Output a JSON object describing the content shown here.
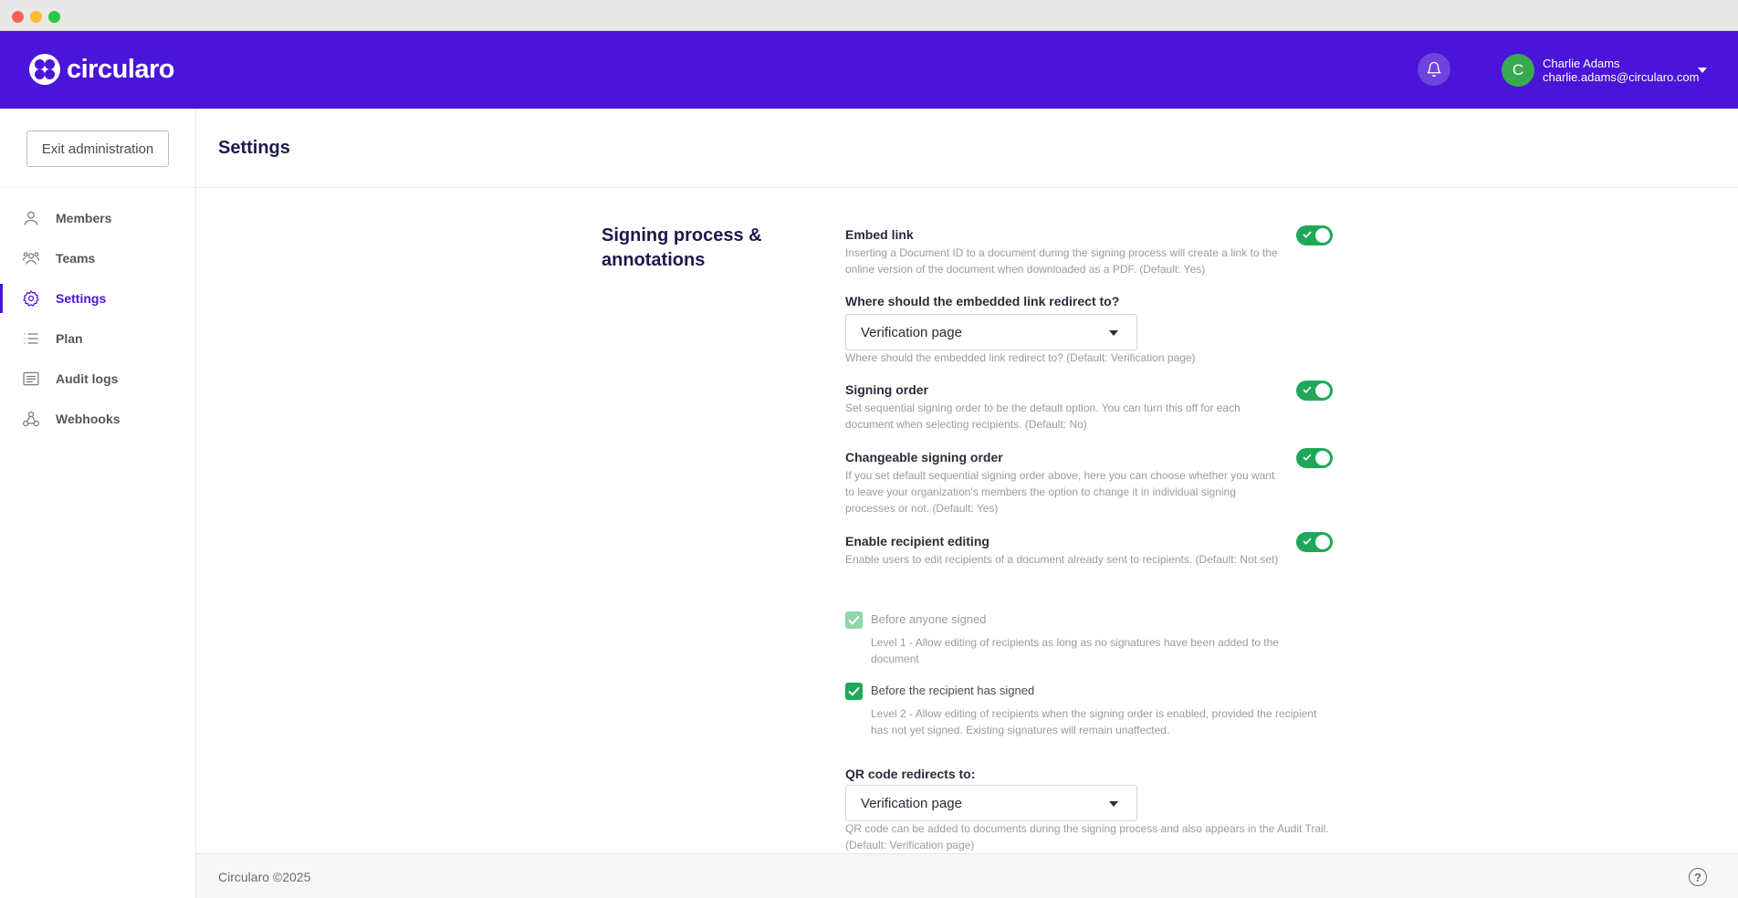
{
  "brand": {
    "name": "circularo",
    "accent": "#4a14d9",
    "toggle_on": "#1fa85a"
  },
  "header": {
    "notification_icon": "bell-icon",
    "user": {
      "initial": "C",
      "name": "Charlie Adams",
      "email": "charlie.adams@circularo.com"
    }
  },
  "sidebar": {
    "exit_label": "Exit administration",
    "items": [
      {
        "label": "Members",
        "icon": "user-icon"
      },
      {
        "label": "Teams",
        "icon": "team-icon"
      },
      {
        "label": "Settings",
        "icon": "gear-icon",
        "active": true
      },
      {
        "label": "Plan",
        "icon": "list-icon"
      },
      {
        "label": "Audit logs",
        "icon": "log-icon"
      },
      {
        "label": "Webhooks",
        "icon": "webhook-icon"
      }
    ]
  },
  "main": {
    "page_title": "Settings",
    "section_title": "Signing process & annotations",
    "embed_link": {
      "label": "Embed link",
      "desc": "Inserting a Document ID to a document during the signing process will create a link to the online version of the document when downloaded as a PDF.  (Default: Yes)",
      "enabled": true
    },
    "redirect": {
      "label": "Where should the embedded link redirect to?",
      "value": "Verification page",
      "helper": "Where should the embedded link redirect to?  (Default: Verification page)"
    },
    "signing_order": {
      "label": "Signing order",
      "desc": "Set sequential signing order to be the default option. You can turn this off for each document when selecting recipients.  (Default: No)",
      "enabled": true
    },
    "changeable_order": {
      "label": "Changeable signing order",
      "desc": "If you set default sequential signing order above, here you can choose whether you want to leave your organization's members the option to change it in individual signing processes or not.  (Default: Yes)",
      "enabled": true
    },
    "recipient_editing": {
      "label": "Enable recipient editing",
      "desc": "Enable users to edit recipients of a document already sent to recipients.  (Default: Not set)",
      "enabled": true,
      "options": [
        {
          "label": "Before anyone signed",
          "desc": "Level 1 - Allow editing of recipients as long as no signatures have been added to the document",
          "checked": true,
          "disabled": true
        },
        {
          "label": "Before the recipient has signed",
          "desc": "Level 2 - Allow editing of recipients when the signing order is enabled, provided the recipient has not yet signed. Existing signatures will remain unaffected.",
          "checked": true,
          "disabled": false
        }
      ]
    },
    "qr_redirect": {
      "label": "QR code redirects to:",
      "value": "Verification page",
      "helper": "QR code can be added to documents during the signing process and also appears in the Audit Trail.  (Default: Verification page)"
    }
  },
  "footer": {
    "copyright": "Circularo ©2025",
    "help_icon": "help-icon",
    "help_glyph": "?"
  }
}
